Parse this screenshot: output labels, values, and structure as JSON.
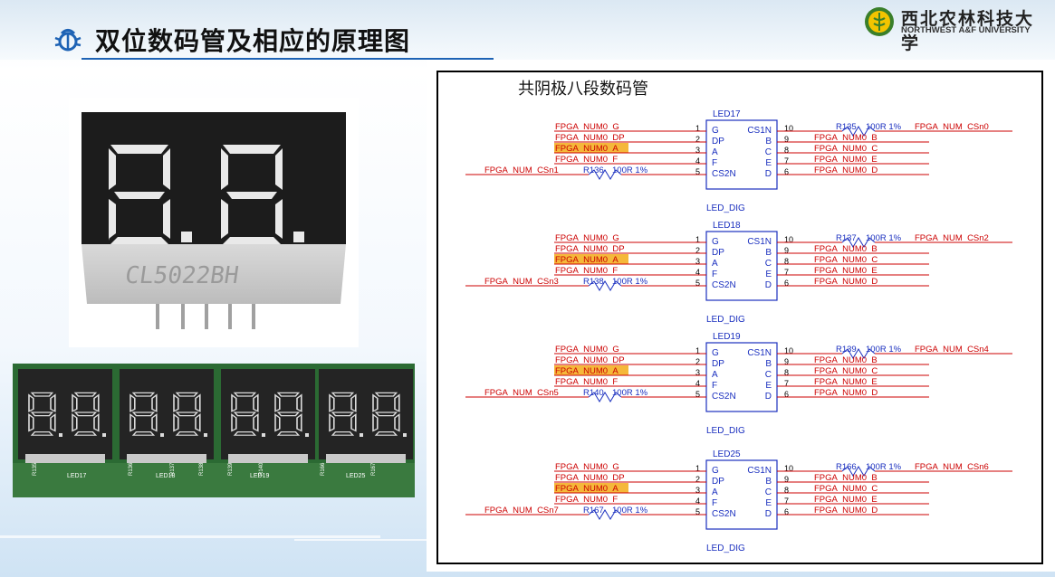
{
  "header": {
    "title": "双位数码管及相应的原理图",
    "logo_cn": "西北农林科技大学",
    "logo_en": "NORTHWEST A&F UNIVERSITY"
  },
  "photo1": {
    "part_marking": "CL5022BH"
  },
  "photo2": {
    "labels": [
      "LED17",
      "LED18",
      "LED19",
      "LED25"
    ],
    "res_labels": [
      "R135",
      "R136",
      "R137",
      "R138",
      "R139",
      "R140",
      "R166",
      "R167"
    ]
  },
  "schematic": {
    "title": "共阴极八段数码管",
    "blocks": [
      {
        "led": "LED17",
        "left_nets": [
          "FPGA_NUM0_G",
          "FPGA_NUM0_DP",
          "FPGA_NUM0_A",
          "FPGA_NUM0_F"
        ],
        "cs_left_net": "FPGA_NUM_CSn1",
        "left_res": "R136",
        "right_res": "R135",
        "res_value": "100R 1%",
        "cs_right_net": "FPGA_NUM_CSn0",
        "right_nets": [
          "FPGA_NUM0_B",
          "FPGA_NUM0_C",
          "FPGA_NUM0_E",
          "FPGA_NUM0_D"
        ],
        "footer": "LED_DIG"
      },
      {
        "led": "LED18",
        "left_nets": [
          "FPGA_NUM0_G",
          "FPGA_NUM0_DP",
          "FPGA_NUM0_A",
          "FPGA_NUM0_F"
        ],
        "cs_left_net": "FPGA_NUM_CSn3",
        "left_res": "R138",
        "right_res": "R137",
        "res_value": "100R 1%",
        "cs_right_net": "FPGA_NUM_CSn2",
        "right_nets": [
          "FPGA_NUM0_B",
          "FPGA_NUM0_C",
          "FPGA_NUM0_E",
          "FPGA_NUM0_D"
        ],
        "footer": "LED_DIG"
      },
      {
        "led": "LED19",
        "left_nets": [
          "FPGA_NUM0_G",
          "FPGA_NUM0_DP",
          "FPGA_NUM0_A",
          "FPGA_NUM0_F"
        ],
        "cs_left_net": "FPGA_NUM_CSn5",
        "left_res": "R140",
        "right_res": "R139",
        "res_value": "100R 1%",
        "cs_right_net": "FPGA_NUM_CSn4",
        "right_nets": [
          "FPGA_NUM0_B",
          "FPGA_NUM0_C",
          "FPGA_NUM0_E",
          "FPGA_NUM0_D"
        ],
        "footer": "LED_DIG"
      },
      {
        "led": "LED25",
        "left_nets": [
          "FPGA_NUM0_G",
          "FPGA_NUM0_DP",
          "FPGA_NUM0_A",
          "FPGA_NUM0_F"
        ],
        "cs_left_net": "FPGA_NUM_CSn7",
        "left_res": "R167",
        "right_res": "R166",
        "res_value": "100R 1%",
        "cs_right_net": "FPGA_NUM_CSn6",
        "right_nets": [
          "FPGA_NUM0_B",
          "FPGA_NUM0_C",
          "FPGA_NUM0_E",
          "FPGA_NUM0_D"
        ],
        "footer": "LED_DIG"
      }
    ],
    "chip_left_pins": [
      "G",
      "DP",
      "A",
      "F",
      "CS2N"
    ],
    "chip_right_pins": [
      "CS1N",
      "B",
      "C",
      "E",
      "D"
    ],
    "left_pin_nums": [
      "1",
      "2",
      "3",
      "4",
      "5"
    ],
    "right_pin_nums": [
      "10",
      "9",
      "8",
      "7",
      "6"
    ]
  },
  "colors": {
    "accent_blue": "#1e63b5",
    "net_red": "#cc0000",
    "chip_blue": "#1a2fbf",
    "highlight": "#f5b83a",
    "led_red": "#d40000",
    "digit_segment": "#e8e8e8"
  }
}
